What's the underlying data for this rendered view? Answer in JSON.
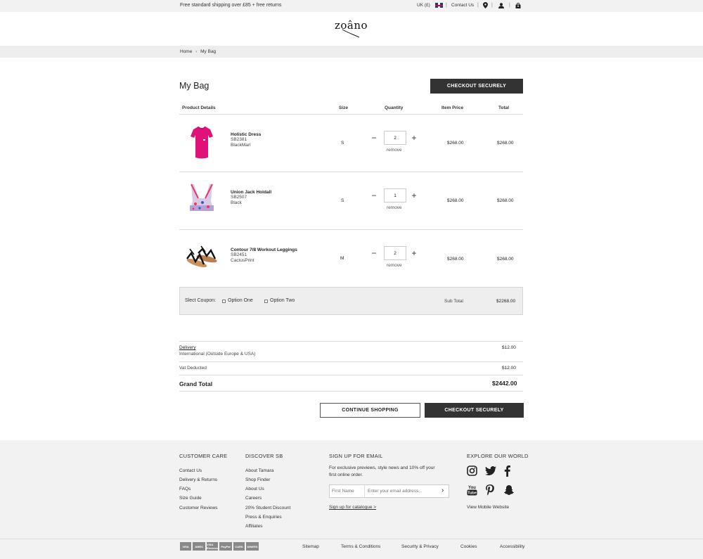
{
  "topbar": {
    "shipping": "Free standard shipping over £85 + free returns",
    "region": "UK (£)",
    "contact": "Contact Us",
    "icons": [
      "location-icon",
      "account-icon",
      "bag-icon"
    ]
  },
  "header": {
    "logo": "zoâno"
  },
  "breadcrumb": {
    "home": "Home",
    "sep": "›",
    "current": "My Bag"
  },
  "page": {
    "title": "My Bag",
    "checkout_label": "CHECKOUT SECURELY"
  },
  "table": {
    "headers": {
      "product": "Product Details",
      "size": "Size",
      "quantity": "Quantity",
      "item_price": "Item Price",
      "total": "Total"
    },
    "items": [
      {
        "name": "Holistic Dress",
        "sku": "SB2381",
        "color": "BlackMarl",
        "size": "S",
        "qty": "2",
        "remove": "remove",
        "price": "$268.00",
        "total": "$268.00"
      },
      {
        "name": "Union Jack Holdall",
        "sku": "SB2507",
        "color": "Black",
        "size": "S",
        "qty": "1",
        "remove": "remove",
        "price": "$268.00",
        "total": "$268.00"
      },
      {
        "name": "Contour 7/8 Workout Leggings",
        "sku": "SB2451",
        "color": "CactusPrint",
        "size": "M",
        "qty": "2",
        "remove": "remove",
        "price": "$268.00",
        "total": "$268.00"
      }
    ]
  },
  "coupon": {
    "label": "Slect Coupon:",
    "option_one": "Option One",
    "option_two": "Option Two",
    "subtotal_label": "Sub Total",
    "subtotal_value": "$2268.00"
  },
  "summary": {
    "delivery_label": "Delivery",
    "delivery_desc": "International (Outside Europe & USA)",
    "delivery_value": "$12.00",
    "vat_label": "Vat Deducted",
    "vat_value": "$12.00",
    "grand_label": "Grand Total",
    "grand_value": "$2442.00"
  },
  "actions": {
    "continue": "CONTINUE SHOPPING",
    "checkout": "CHECKOUT SECURELY"
  },
  "footer": {
    "customer_care": {
      "title": "CUSTOMER CARE",
      "links": [
        "Contact Us",
        "Delivery & Returns",
        "FAQs",
        "Size Guide",
        "Customer Reviews"
      ]
    },
    "discover": {
      "title": "DISCOVER SB",
      "links": [
        "About Tamara",
        "Shop Finder",
        "About Us",
        "Careers",
        "20% Student Discount",
        "Press & Enquiries",
        "Affiliates"
      ]
    },
    "signup": {
      "title": "SIGN UP FOR EMAIL",
      "text": "For exclusive previews, style news and 10% off your first online order.",
      "first_name_placeholder": "First Name",
      "email_placeholder": "Enter your email address...",
      "catalogue": "Sign up for catalogue >"
    },
    "explore": {
      "title": "EXPLORE OUR WORLD",
      "icons": [
        "instagram-icon",
        "twitter-icon",
        "facebook-icon",
        "youtube-icon",
        "pinterest-icon",
        "snapchat-icon"
      ],
      "mobile": "View Mobile Website"
    },
    "bottom_links": [
      "Sitemap",
      "Terms & Conditions",
      "Security & Privacy",
      "Cookies",
      "Accessibility"
    ],
    "cards": [
      "VISA",
      "AMEX",
      "VISA Electron",
      "PayPal",
      "CARD",
      "DINERS"
    ]
  }
}
